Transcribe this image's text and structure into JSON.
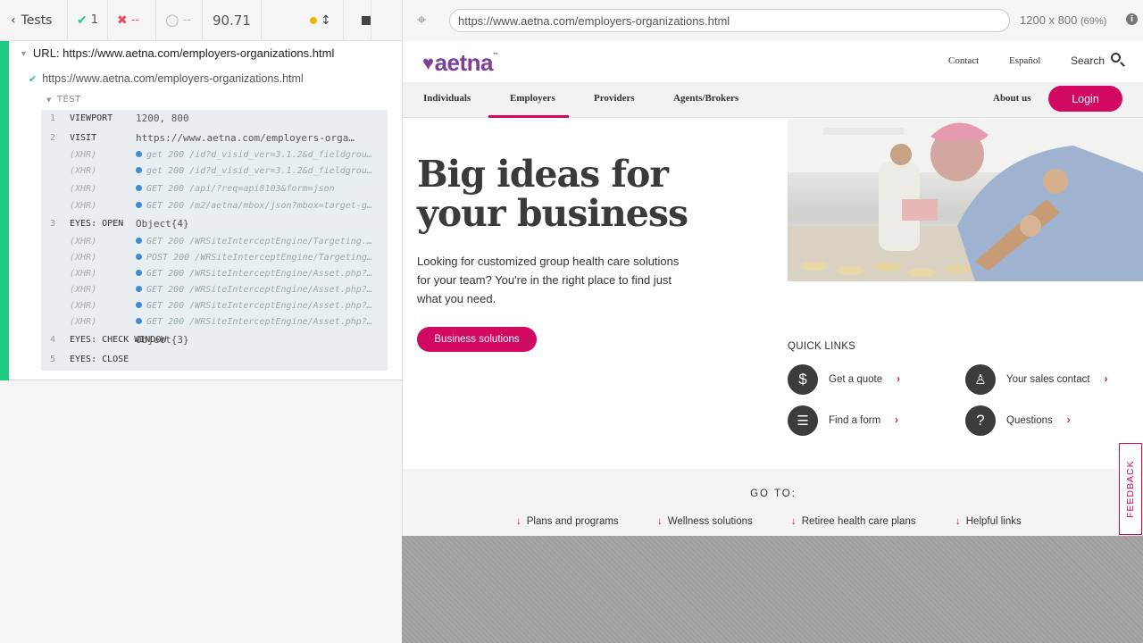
{
  "runner": {
    "tests_label": "Tests",
    "passed": "1",
    "failed": "--",
    "pending": "--",
    "duration": "90.71"
  },
  "reporter": {
    "suite_title": "URL: https://www.aetna.com/employers-organizations.html",
    "test_title": "https://www.aetna.com/employers-organizations.html",
    "test_label": "TEST",
    "commands": [
      {
        "num": "1",
        "name": "VIEWPORT",
        "msg": "1200, 800",
        "xhr": false
      },
      {
        "num": "2",
        "name": "VISIT",
        "msg": "https://www.aetna.com/employers-orga…",
        "xhr": false
      },
      {
        "num": "",
        "name": "(XHR)",
        "msg": "get 200 /id?d_visid_ver=3.1.2&d_fieldgrou…",
        "xhr": true
      },
      {
        "num": "",
        "name": "(XHR)",
        "msg": "get 200 /id?d_visid_ver=3.1.2&d_fieldgrou…",
        "xhr": true
      },
      {
        "num": "",
        "name": "(XHR)",
        "msg": "GET 200 /api/?req=api8103&form=json",
        "xhr": true
      },
      {
        "num": "",
        "name": "(XHR)",
        "msg": "GET 200 /m2/aetna/mbox/json?mbox=target-g…",
        "xhr": true
      },
      {
        "num": "3",
        "name": "EYES: OPEN",
        "msg": "Object{4}",
        "xhr": false
      },
      {
        "num": "",
        "name": "(XHR)",
        "msg": "GET 200 /WRSiteInterceptEngine/Targeting.…",
        "xhr": true
      },
      {
        "num": "",
        "name": "(XHR)",
        "msg": "POST 200 /WRSiteInterceptEngine/Targeting…",
        "xhr": true
      },
      {
        "num": "",
        "name": "(XHR)",
        "msg": "GET 200 /WRSiteInterceptEngine/Asset.php?…",
        "xhr": true
      },
      {
        "num": "",
        "name": "(XHR)",
        "msg": "GET 200 /WRSiteInterceptEngine/Asset.php?…",
        "xhr": true
      },
      {
        "num": "",
        "name": "(XHR)",
        "msg": "GET 200 /WRSiteInterceptEngine/Asset.php?…",
        "xhr": true
      },
      {
        "num": "",
        "name": "(XHR)",
        "msg": "GET 200 /WRSiteInterceptEngine/Asset.php?…",
        "xhr": true
      },
      {
        "num": "4",
        "name": "EYES: CHECK WINDOW",
        "msg": "Object{3}",
        "xhr": false
      },
      {
        "num": "5",
        "name": "EYES: CLOSE",
        "msg": "",
        "xhr": false
      }
    ]
  },
  "aut_header": {
    "url": "https://www.aetna.com/employers-organizations.html",
    "viewport": "1200 x 800",
    "scale": "(69%)"
  },
  "site": {
    "logo": "aetna",
    "util_links": [
      "Contact",
      "Español",
      "Search"
    ],
    "nav": [
      "Individuals",
      "Employers",
      "Providers",
      "Agents/Brokers"
    ],
    "about": "About us",
    "login": "Login",
    "hero_title": "Big ideas for your business",
    "hero_text": "Looking for customized group health care solutions for your team? You're in the right place to find just what you need.",
    "hero_button": "Business solutions",
    "quick_links_title": "QUICK LINKS",
    "quick_links": [
      "Get a quote",
      "Your sales contact",
      "Find a form",
      "Questions"
    ],
    "goto_title": "GO TO:",
    "goto_links": [
      "Plans and programs",
      "Wellness solutions",
      "Retiree health care plans",
      "Helpful links"
    ],
    "feedback": "FEEDBACK"
  },
  "colors": {
    "brand_purple": "#7d3f98",
    "brand_magenta": "#d20962",
    "pass_green": "#1fc97f"
  }
}
